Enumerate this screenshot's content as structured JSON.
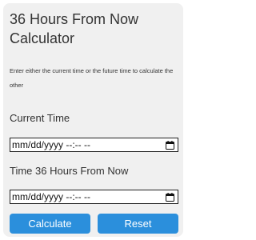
{
  "calculator": {
    "title": "36 Hours From Now Calculator",
    "description": "Enter either the current time or the future time to calculate the other",
    "current_label": "Current Time",
    "current_placeholder": "mm/dd/yyyy --:-- --",
    "future_label": "Time 36 Hours From Now",
    "future_placeholder": "mm/dd/yyyy --:-- --",
    "calculate_label": "Calculate",
    "reset_label": "Reset"
  },
  "colors": {
    "card_bg": "#f0f0f0",
    "button_bg": "#2b8fdc",
    "button_text": "#ffffff",
    "text": "#333333"
  },
  "icons": {
    "date_picker": "calendar-icon"
  }
}
